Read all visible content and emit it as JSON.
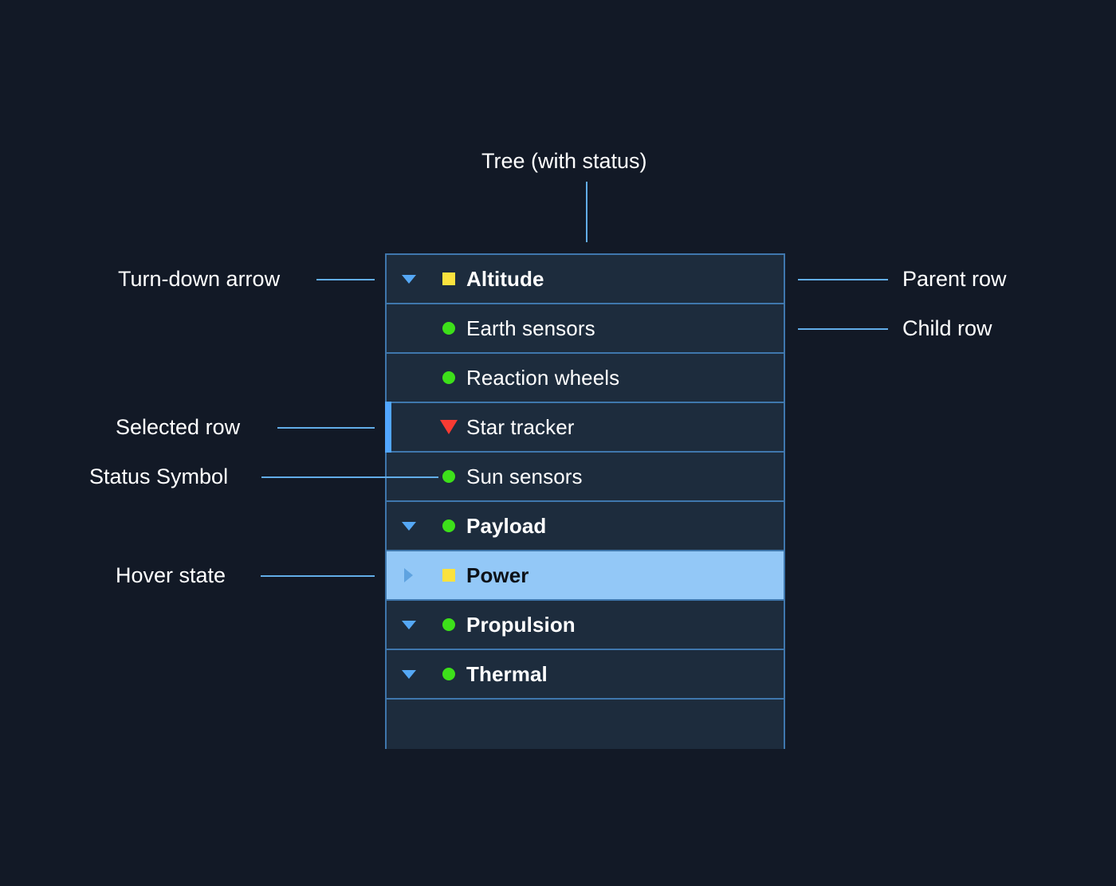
{
  "colors": {
    "page_background": "#121926",
    "panel_background": "#1d2c3d",
    "panel_border": "#3f77ad",
    "leader_line": "#62ade8",
    "selected_bar": "#51a6ff",
    "hover_background": "#93c8f7",
    "hover_text": "#0d1117",
    "status_ok": "#3de01a",
    "status_warning": "#fbe23e",
    "status_error": "#f93b33",
    "arrow": "#55a8f5",
    "label_text": "#ffffff"
  },
  "annotations": {
    "top": "Tree (with status)",
    "turn_down_arrow": "Turn-down arrow",
    "selected_row": "Selected row",
    "status_symbol": "Status Symbol",
    "hover_state": "Hover state",
    "parent_row": "Parent row",
    "child_row": "Child row"
  },
  "tree": {
    "rows": [
      {
        "label": "Altitude",
        "level": "parent",
        "arrow": "turn-down-arrow",
        "status": "square-yellow",
        "state": "normal"
      },
      {
        "label": "Earth sensors",
        "level": "child",
        "arrow": "none",
        "status": "circle-green",
        "state": "normal"
      },
      {
        "label": "Reaction wheels",
        "level": "child",
        "arrow": "none",
        "status": "circle-green",
        "state": "normal"
      },
      {
        "label": "Star tracker",
        "level": "child",
        "arrow": "none",
        "status": "triangle-red",
        "state": "selected"
      },
      {
        "label": "Sun sensors",
        "level": "child",
        "arrow": "none",
        "status": "circle-green",
        "state": "normal"
      },
      {
        "label": "Payload",
        "level": "parent",
        "arrow": "turn-down-arrow",
        "status": "circle-green",
        "state": "normal"
      },
      {
        "label": "Power",
        "level": "parent",
        "arrow": "turn-right-arrow",
        "status": "square-yellow",
        "state": "hover"
      },
      {
        "label": "Propulsion",
        "level": "parent",
        "arrow": "turn-down-arrow",
        "status": "circle-green",
        "state": "normal"
      },
      {
        "label": "Thermal",
        "level": "parent",
        "arrow": "turn-down-arrow",
        "status": "circle-green",
        "state": "normal"
      },
      {
        "label": "",
        "level": "empty",
        "arrow": "none",
        "status": "none",
        "state": "normal"
      }
    ]
  }
}
